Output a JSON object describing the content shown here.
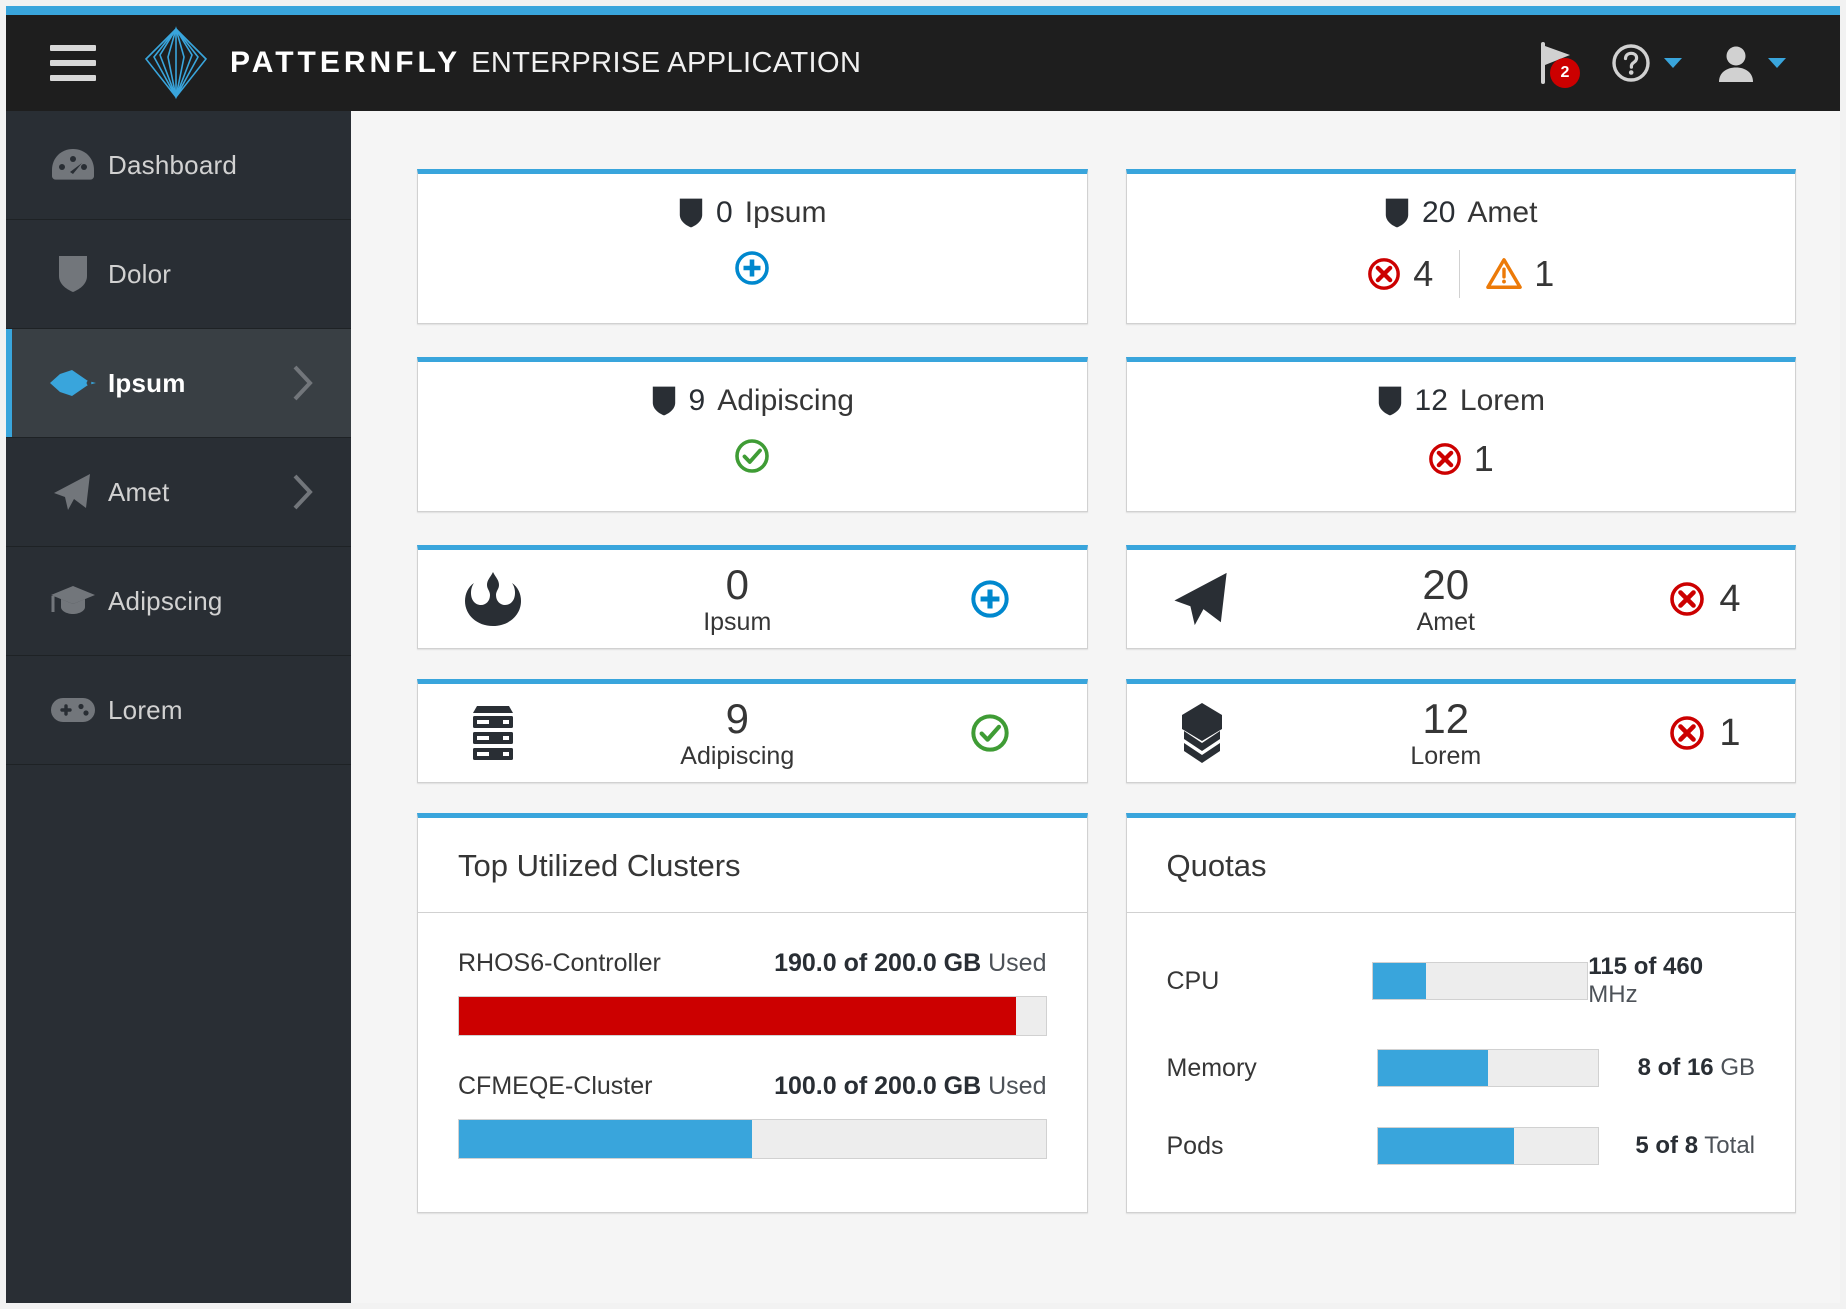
{
  "accent_color": "#39a5dc",
  "header": {
    "menu_icon": "hamburger-icon",
    "logo_icon": "patternfly-logo",
    "brand_bold": "PATTERNFLY",
    "brand_light": "ENTERPRISE APPLICATION",
    "notification_icon": "flag-icon",
    "notification_count": "2",
    "help_icon": "help-circle-icon",
    "user_icon": "user-icon"
  },
  "sidebar": {
    "items": [
      {
        "label": "Dashboard",
        "icon": "dashboard-icon",
        "active": false,
        "expandable": false
      },
      {
        "label": "Dolor",
        "icon": "shield-icon",
        "active": false,
        "expandable": false
      },
      {
        "label": "Ipsum",
        "icon": "rocket-icon",
        "active": true,
        "expandable": true
      },
      {
        "label": "Amet",
        "icon": "paper-plane-icon",
        "active": false,
        "expandable": true
      },
      {
        "label": "Adipscing",
        "icon": "graduation-cap-icon",
        "active": false,
        "expandable": false
      },
      {
        "label": "Lorem",
        "icon": "gamepad-icon",
        "active": false,
        "expandable": false
      }
    ]
  },
  "aggregate_cards": [
    {
      "icon": "shield-icon",
      "count": "0",
      "title": "Ipsum",
      "stats": [
        {
          "icon": "add-circle-icon",
          "color": "#0088ce",
          "value": ""
        }
      ]
    },
    {
      "icon": "shield-icon",
      "count": "20",
      "title": "Amet",
      "stats": [
        {
          "icon": "error-circle-icon",
          "color": "#cc0000",
          "value": "4"
        },
        {
          "icon": "warning-triangle-icon",
          "color": "#ec7a08",
          "value": "1"
        }
      ]
    },
    {
      "icon": "shield-icon",
      "count": "9",
      "title": "Adipiscing",
      "stats": [
        {
          "icon": "check-circle-icon",
          "color": "#3f9c35",
          "value": ""
        }
      ]
    },
    {
      "icon": "shield-icon",
      "count": "12",
      "title": "Lorem",
      "stats": [
        {
          "icon": "error-circle-icon",
          "color": "#cc0000",
          "value": "1"
        }
      ]
    }
  ],
  "mini_cards": [
    {
      "icon": "rebel-icon",
      "count": "0",
      "label": "Ipsum",
      "status_icon": "add-circle-icon",
      "status_color": "#0088ce",
      "status_value": ""
    },
    {
      "icon": "paper-plane-icon",
      "count": "20",
      "label": "Amet",
      "status_icon": "error-circle-icon",
      "status_color": "#cc0000",
      "status_value": "4"
    },
    {
      "icon": "server-rack-icon",
      "count": "9",
      "label": "Adipiscing",
      "status_icon": "check-circle-icon",
      "status_color": "#3f9c35",
      "status_value": ""
    },
    {
      "icon": "chevron-badge-icon",
      "count": "12",
      "label": "Lorem",
      "status_icon": "error-circle-icon",
      "status_color": "#cc0000",
      "status_value": "1"
    }
  ],
  "utilization_panel": {
    "title": "Top Utilized Clusters",
    "rows": [
      {
        "name": "RHOS6-Controller",
        "used": "190.0",
        "total": "200.0",
        "unit": "GB",
        "suffix": "Used",
        "percent": 95,
        "bar_color": "#cc0000"
      },
      {
        "name": "CFMEQE-Cluster",
        "used": "100.0",
        "total": "200.0",
        "unit": "GB",
        "suffix": "Used",
        "percent": 50,
        "bar_color": "#39a5dc"
      }
    ]
  },
  "quotas_panel": {
    "title": "Quotas",
    "rows": [
      {
        "label": "CPU",
        "used": "115",
        "total": "460",
        "unit": "MHz",
        "percent": 25
      },
      {
        "label": "Memory",
        "used": "8",
        "total": "16",
        "unit": "GB",
        "percent": 50
      },
      {
        "label": "Pods",
        "used": "5",
        "total": "8",
        "unit": "Total",
        "percent": 62
      }
    ]
  }
}
